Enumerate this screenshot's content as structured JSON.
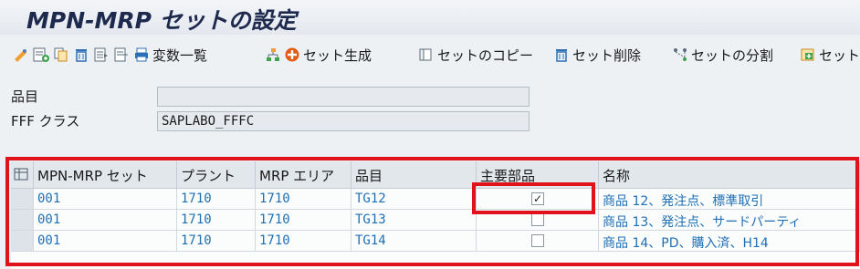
{
  "title": "MPN-MRP セットの設定",
  "toolbar": {
    "variables_label": "変数一覧",
    "generate_label": "セット生成",
    "copy_label": "セットのコピー",
    "delete_label": "セット削除",
    "split_label": "セットの分割",
    "more_label": "セットの"
  },
  "form": {
    "material_label": "品目",
    "material_value": "",
    "fff_label": "FFF クラス",
    "fff_value": "SAPLABO_FFFC"
  },
  "table": {
    "columns": [
      "MPN-MRP セット",
      "プラント",
      "MRP エリア",
      "品目",
      "主要部品",
      "名称"
    ],
    "rows": [
      {
        "set": "001",
        "plant": "1710",
        "mrp_area": "1710",
        "material": "TG12",
        "main_part": true,
        "name": "商品 12、発注点、標準取引"
      },
      {
        "set": "001",
        "plant": "1710",
        "mrp_area": "1710",
        "material": "TG13",
        "main_part": false,
        "name": "商品 13、発注点、サードパーティ"
      },
      {
        "set": "001",
        "plant": "1710",
        "mrp_area": "1710",
        "material": "TG14",
        "main_part": false,
        "name": "商品 14、PD、購入済、H14"
      }
    ]
  },
  "colors": {
    "link": "#1f6fb5",
    "highlight": "#e0121b"
  }
}
